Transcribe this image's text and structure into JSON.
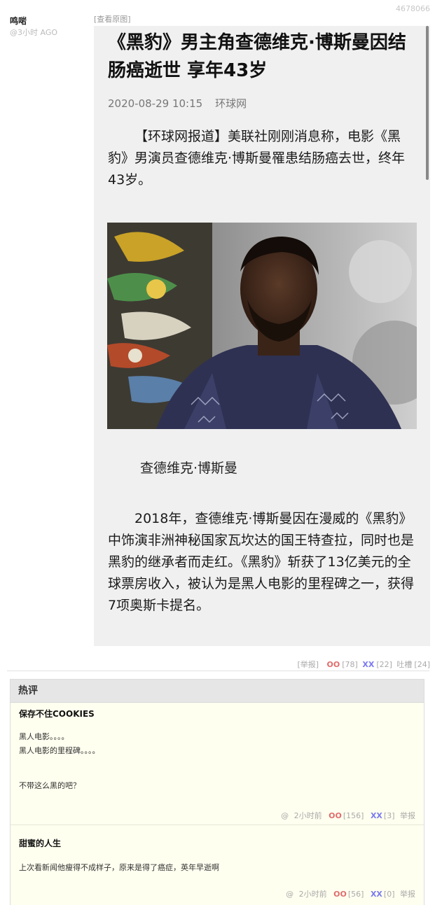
{
  "post": {
    "id": "4678066",
    "author": "鸣啱",
    "time": "@3小时 AGO",
    "view_original": "[查看原图]"
  },
  "article": {
    "title": "《黑豹》男主角查德维克·博斯曼因结肠癌逝世 享年43岁",
    "date": "2020-08-29 10:15",
    "source": "环球网",
    "paragraph1": "【环球网报道】美联社刚刚消息称，电影《黑豹》男演员查德维克·博斯曼罹患结肠癌去世，终年43岁。",
    "caption": "查德维克·博斯曼",
    "paragraph2": "2018年，查德维克·博斯曼因在漫威的《黑豹》中饰演非洲神秘国家瓦坎达的国王特查拉，同时也是黑豹的继承者而走红。《黑豹》斩获了13亿美元的全球票房收入，被认为是黑人电影的里程碑之一，获得7项奥斯卡提名。"
  },
  "post_actions": {
    "report": "[举报]",
    "oo_label": "OO",
    "oo_count": "[78]",
    "xx_label": "XX",
    "xx_count": "[22]",
    "tucao_label": "吐槽",
    "tucao_count": "[24]"
  },
  "hot_comments": {
    "title": "热评",
    "comments": [
      {
        "author": "保存不住COOKIES",
        "lines": [
          "黑人电影。。。。",
          "黑人电影的里程碑。。。。",
          "",
          "不带这么黑的吧？"
        ],
        "at": "@",
        "time": "2小时前",
        "oo_label": "OO",
        "oo_count": "[156]",
        "xx_label": "XX",
        "xx_count": "[3]",
        "report": "举报"
      },
      {
        "author": "甜蜜的人生",
        "lines": [
          "上次看新闻他瘦得不成样子，原来是得了癌症，英年早逝啊"
        ],
        "at": "@",
        "time": "2小时前",
        "oo_label": "OO",
        "oo_count": "[56]",
        "xx_label": "XX",
        "xx_count": "[0]",
        "report": "举报"
      }
    ]
  },
  "colors": {
    "oo": "#e06c6c",
    "xx": "#7a7af0",
    "comment_bg": "#fffff0",
    "article_bg": "#f0f0f0"
  }
}
